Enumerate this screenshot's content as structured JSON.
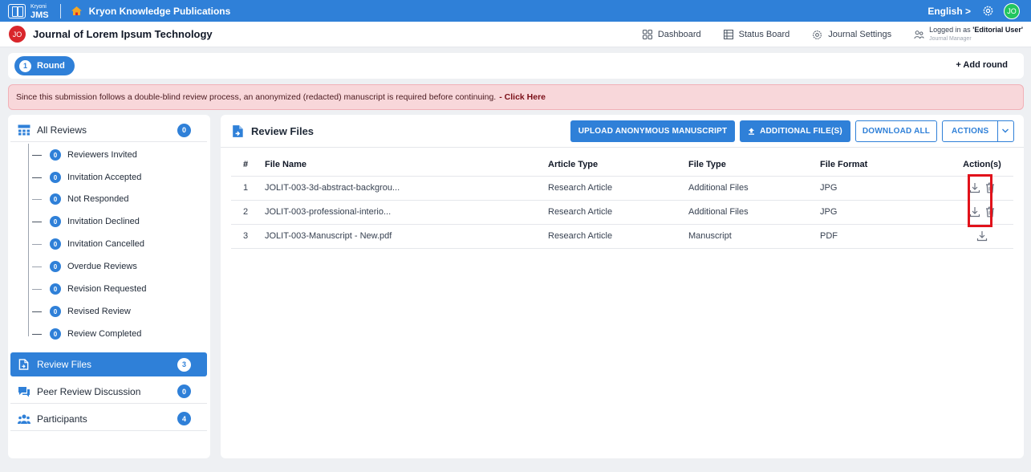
{
  "topbar": {
    "logo_small": "Kryoni",
    "logo_big": "JMS",
    "publisher": "Kryon Knowledge Publications",
    "language": "English >",
    "avatar_initials": "JO"
  },
  "journal": {
    "badge": "JO",
    "title": "Journal of Lorem Ipsum Technology",
    "nav": {
      "dashboard": "Dashboard",
      "status_board": "Status Board",
      "journal_settings": "Journal Settings"
    },
    "login_prefix": "Logged in as",
    "login_user": "'Editorial User'",
    "login_role": "Journal Manager"
  },
  "round": {
    "number": "1",
    "label": "Round",
    "add_label": "+ Add round"
  },
  "alert": {
    "message": "Since this submission follows a double-blind review process, an anonymized (redacted) manuscript is required before continuing.",
    "link": "- Click Here"
  },
  "sidebar": {
    "all_reviews": {
      "label": "All Reviews",
      "count": "0"
    },
    "sub_items": [
      {
        "label": "Reviewers Invited",
        "count": "0"
      },
      {
        "label": "Invitation Accepted",
        "count": "0"
      },
      {
        "label": "Not Responded",
        "count": "0"
      },
      {
        "label": "Invitation Declined",
        "count": "0"
      },
      {
        "label": "Invitation Cancelled",
        "count": "0"
      },
      {
        "label": "Overdue Reviews",
        "count": "0"
      },
      {
        "label": "Revision Requested",
        "count": "0"
      },
      {
        "label": "Revised Review",
        "count": "0"
      },
      {
        "label": "Review Completed",
        "count": "0"
      }
    ],
    "review_files": {
      "label": "Review Files",
      "count": "3"
    },
    "peer_discussion": {
      "label": "Peer Review Discussion",
      "count": "0"
    },
    "participants": {
      "label": "Participants",
      "count": "4"
    }
  },
  "main": {
    "title": "Review Files",
    "buttons": {
      "upload": "UPLOAD ANONYMOUS MANUSCRIPT",
      "additional": "ADDITIONAL FILE(S)",
      "download_all": "DOWNLOAD ALL",
      "actions": "ACTIONS"
    },
    "columns": [
      "#",
      "File Name",
      "Article Type",
      "File Type",
      "File Format",
      "Action(s)"
    ],
    "rows": [
      {
        "num": "1",
        "name": "JOLIT-003-3d-abstract-backgrou...",
        "article": "Research Article",
        "type": "Additional Files",
        "format": "JPG"
      },
      {
        "num": "2",
        "name": "JOLIT-003-professional-interio...",
        "article": "Research Article",
        "type": "Additional Files",
        "format": "JPG"
      },
      {
        "num": "3",
        "name": "JOLIT-003-Manuscript - New.pdf",
        "article": "Research Article",
        "type": "Manuscript",
        "format": "PDF"
      }
    ]
  },
  "colors": {
    "primary": "#2f80d8",
    "alert_bg": "#f8d7da",
    "avatar_green": "#22c55e",
    "journal_badge": "#d9262b",
    "highlight": "#e1121b"
  }
}
